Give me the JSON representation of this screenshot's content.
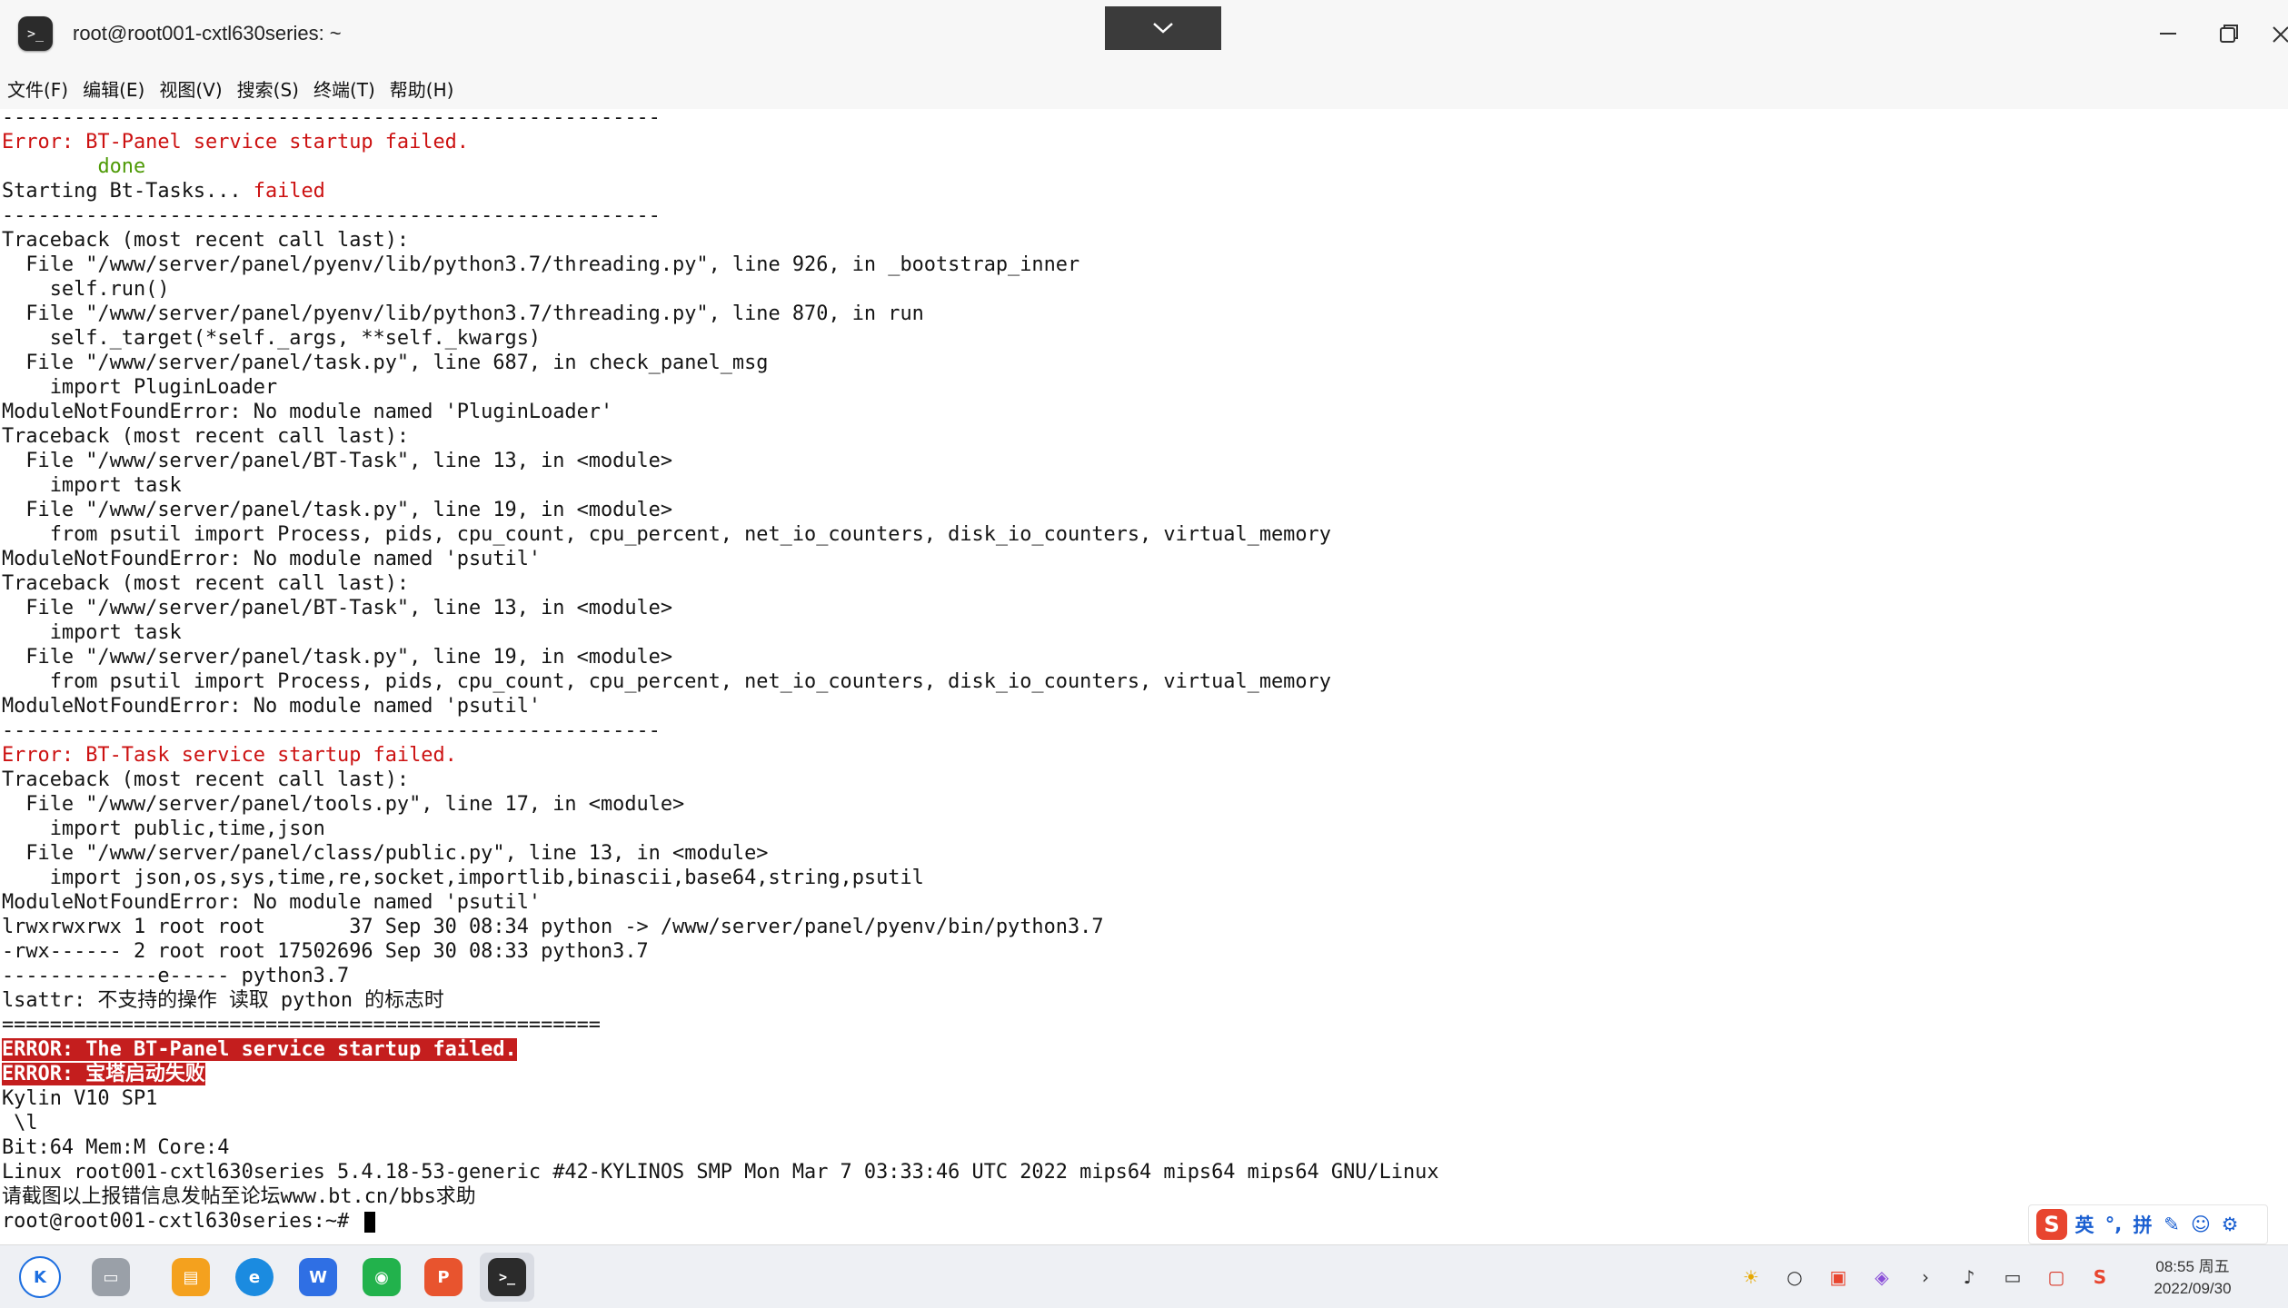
{
  "window": {
    "title": "root@root001-cxtl630series: ~",
    "app_icon_glyph": ">_"
  },
  "menu": [
    "文件(F)",
    "编辑(E)",
    "视图(V)",
    "搜索(S)",
    "终端(T)",
    "帮助(H)"
  ],
  "terminal": {
    "colors": {
      "error_red": "#cc1111",
      "ok_green": "#4e9a06",
      "highlight_bg": "#c41e1e"
    },
    "lines": [
      [
        {
          "t": "-------------------------------------------------------"
        }
      ],
      [
        {
          "t": "Error: BT-Panel service startup failed.",
          "c": "red"
        }
      ],
      [
        {
          "t": "        "
        },
        {
          "t": "done",
          "c": "green"
        }
      ],
      [
        {
          "t": "Starting Bt-Tasks... "
        },
        {
          "t": "failed",
          "c": "red"
        }
      ],
      [
        {
          "t": "-------------------------------------------------------"
        }
      ],
      [
        {
          "t": "Traceback (most recent call last):"
        }
      ],
      [
        {
          "t": "  File \"/www/server/panel/pyenv/lib/python3.7/threading.py\", line 926, in _bootstrap_inner"
        }
      ],
      [
        {
          "t": "    self.run()"
        }
      ],
      [
        {
          "t": "  File \"/www/server/panel/pyenv/lib/python3.7/threading.py\", line 870, in run"
        }
      ],
      [
        {
          "t": "    self._target(*self._args, **self._kwargs)"
        }
      ],
      [
        {
          "t": "  File \"/www/server/panel/task.py\", line 687, in check_panel_msg"
        }
      ],
      [
        {
          "t": "    import PluginLoader"
        }
      ],
      [
        {
          "t": "ModuleNotFoundError: No module named 'PluginLoader'"
        }
      ],
      [
        {
          "t": "Traceback (most recent call last):"
        }
      ],
      [
        {
          "t": "  File \"/www/server/panel/BT-Task\", line 13, in <module>"
        }
      ],
      [
        {
          "t": "    import task"
        }
      ],
      [
        {
          "t": "  File \"/www/server/panel/task.py\", line 19, in <module>"
        }
      ],
      [
        {
          "t": "    from psutil import Process, pids, cpu_count, cpu_percent, net_io_counters, disk_io_counters, virtual_memory"
        }
      ],
      [
        {
          "t": "ModuleNotFoundError: No module named 'psutil'"
        }
      ],
      [
        {
          "t": "Traceback (most recent call last):"
        }
      ],
      [
        {
          "t": "  File \"/www/server/panel/BT-Task\", line 13, in <module>"
        }
      ],
      [
        {
          "t": "    import task"
        }
      ],
      [
        {
          "t": "  File \"/www/server/panel/task.py\", line 19, in <module>"
        }
      ],
      [
        {
          "t": "    from psutil import Process, pids, cpu_count, cpu_percent, net_io_counters, disk_io_counters, virtual_memory"
        }
      ],
      [
        {
          "t": "ModuleNotFoundError: No module named 'psutil'"
        }
      ],
      [
        {
          "t": "-------------------------------------------------------"
        }
      ],
      [
        {
          "t": "Error: BT-Task service startup failed.",
          "c": "red"
        }
      ],
      [
        {
          "t": "Traceback (most recent call last):"
        }
      ],
      [
        {
          "t": "  File \"/www/server/panel/tools.py\", line 17, in <module>"
        }
      ],
      [
        {
          "t": "    import public,time,json"
        }
      ],
      [
        {
          "t": "  File \"/www/server/panel/class/public.py\", line 13, in <module>"
        }
      ],
      [
        {
          "t": "    import json,os,sys,time,re,socket,importlib,binascii,base64,string,psutil"
        }
      ],
      [
        {
          "t": "ModuleNotFoundError: No module named 'psutil'"
        }
      ],
      [
        {
          "t": "lrwxrwxrwx 1 root root       37 Sep 30 08:34 python -> /www/server/panel/pyenv/bin/python3.7"
        }
      ],
      [
        {
          "t": "-rwx------ 2 root root 17502696 Sep 30 08:33 python3.7"
        }
      ],
      [
        {
          "t": "-------------e----- python3.7"
        }
      ],
      [
        {
          "t": "lsattr: 不支持的操作 读取 python 的标志时"
        }
      ],
      [
        {
          "t": "=================================================="
        }
      ],
      [
        {
          "t": "ERROR: The BT-Panel service startup failed.",
          "c": "hl"
        }
      ],
      [
        {
          "t": "ERROR: 宝塔启动失败",
          "c": "hl"
        }
      ],
      [
        {
          "t": "Kylin V10 SP1"
        }
      ],
      [
        {
          "t": " \\l"
        }
      ],
      [
        {
          "t": "Bit:64 Mem:M Core:4"
        }
      ],
      [
        {
          "t": "Linux root001-cxtl630series 5.4.18-53-generic #42-KYLINOS SMP Mon Mar 7 03:33:46 UTC 2022 mips64 mips64 mips64 GNU/Linux"
        }
      ],
      [
        {
          "t": "请截图以上报错信息发帖至论坛www.bt.cn/bbs求助"
        }
      ],
      [
        {
          "t": "root@root001-cxtl630series:~# "
        }
      ]
    ]
  },
  "ime": {
    "logo": "S",
    "items": [
      "英",
      "°,",
      "拼",
      "✎",
      "☺",
      "⚙"
    ]
  },
  "taskbar": {
    "apps": [
      {
        "name": "start-menu",
        "glyph": "K",
        "color": "#1e6fe0"
      },
      {
        "name": "multitask-view",
        "glyph": "▭",
        "color": "#9aa0a8"
      },
      {
        "name": "file-manager",
        "glyph": "▤",
        "color": "#f4a11e"
      },
      {
        "name": "browser",
        "glyph": "e",
        "color": "#1b8be0"
      },
      {
        "name": "wps-writer",
        "glyph": "W",
        "color": "#2f6fe4"
      },
      {
        "name": "wechat",
        "glyph": "◉",
        "color": "#22b24c"
      },
      {
        "name": "wps-presentation",
        "glyph": "P",
        "color": "#e8542e"
      },
      {
        "name": "terminal",
        "glyph": ">_",
        "color": "#2b2b2b"
      }
    ],
    "tray": [
      "☀",
      "○",
      "▣",
      "◈",
      "›",
      "♪",
      "▭",
      "▢",
      "S"
    ],
    "clock_time": "08:55 周五",
    "clock_date": "2022/09/30"
  }
}
